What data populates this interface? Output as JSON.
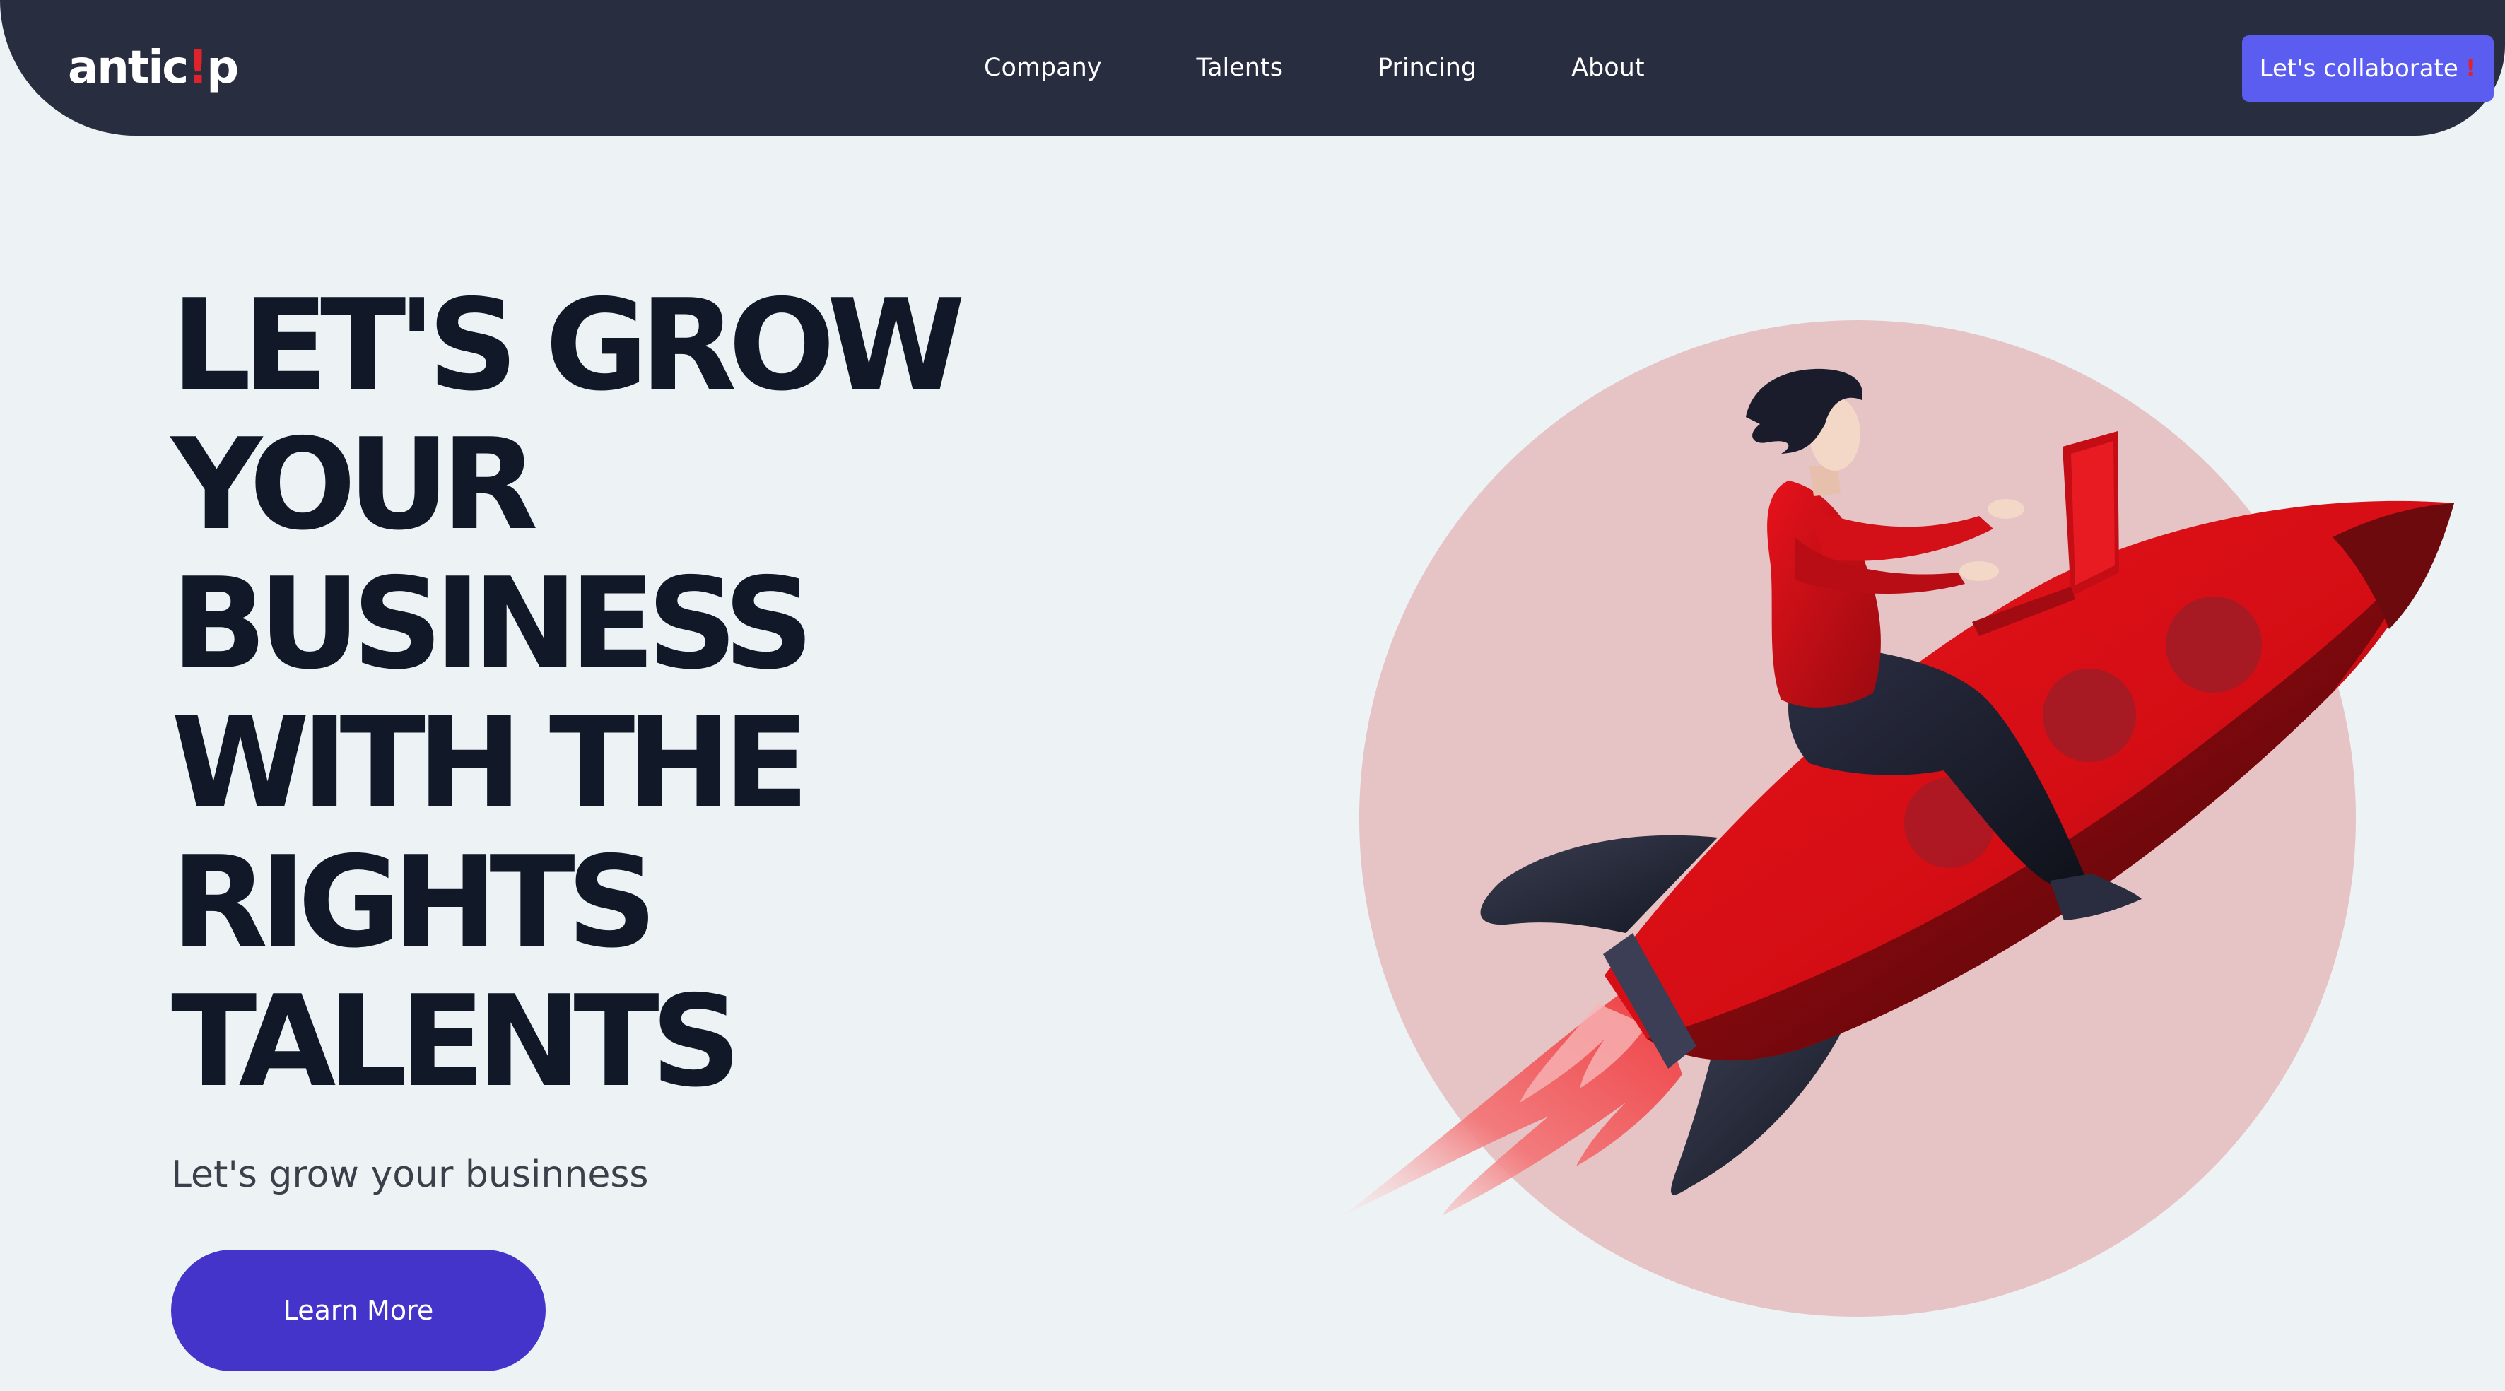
{
  "navbar": {
    "logo_text": "antic",
    "logo_bang": "!",
    "logo_tail": "p",
    "links": [
      {
        "label": "Company"
      },
      {
        "label": "Talents"
      },
      {
        "label": "Princing"
      },
      {
        "label": "About"
      }
    ],
    "cta_label": "Let's collaborate",
    "cta_bang": "!"
  },
  "hero": {
    "title_lines": [
      "LET'S GROW",
      "YOUR",
      "BUSINESS",
      "WITH THE",
      "RIGHTS",
      "TALENTS"
    ],
    "subtitle": "Let's grow your businness",
    "button_label": "Learn More"
  },
  "illustration": {
    "icon": "rocket-rider-illustration"
  },
  "colors": {
    "navbar_bg": "#292d40",
    "cta_bg": "#5b5cf0",
    "accent_red": "#e0222b",
    "button_bg": "#4434c9",
    "page_bg": "#edf2f4",
    "circle_bg": "#e6c3c4"
  }
}
